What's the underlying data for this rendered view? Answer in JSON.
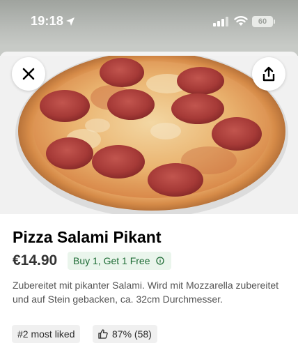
{
  "status_bar": {
    "time": "19:18",
    "battery": "60"
  },
  "product": {
    "name": "Pizza Salami Pikant",
    "price": "€14.90",
    "promo_label": "Buy 1, Get 1 Free",
    "description": "Zubereitet mit pikanter Salami. Wird mit Mozzarella zubereitet und auf Stein gebacken, ca. 32cm Durchmesser.",
    "popularity_badge": "#2 most liked",
    "rating_label": "87% (58)"
  },
  "icons": {
    "close": "close-icon",
    "share": "share-icon",
    "info": "info-icon",
    "thumbs_up": "thumbs-up-icon",
    "location": "location-arrow-icon",
    "signal": "signal-icon",
    "wifi": "wifi-icon"
  },
  "colors": {
    "promo_bg": "#eaf5ec",
    "promo_text": "#1d6b34",
    "chip_bg": "#f0f0f0"
  }
}
